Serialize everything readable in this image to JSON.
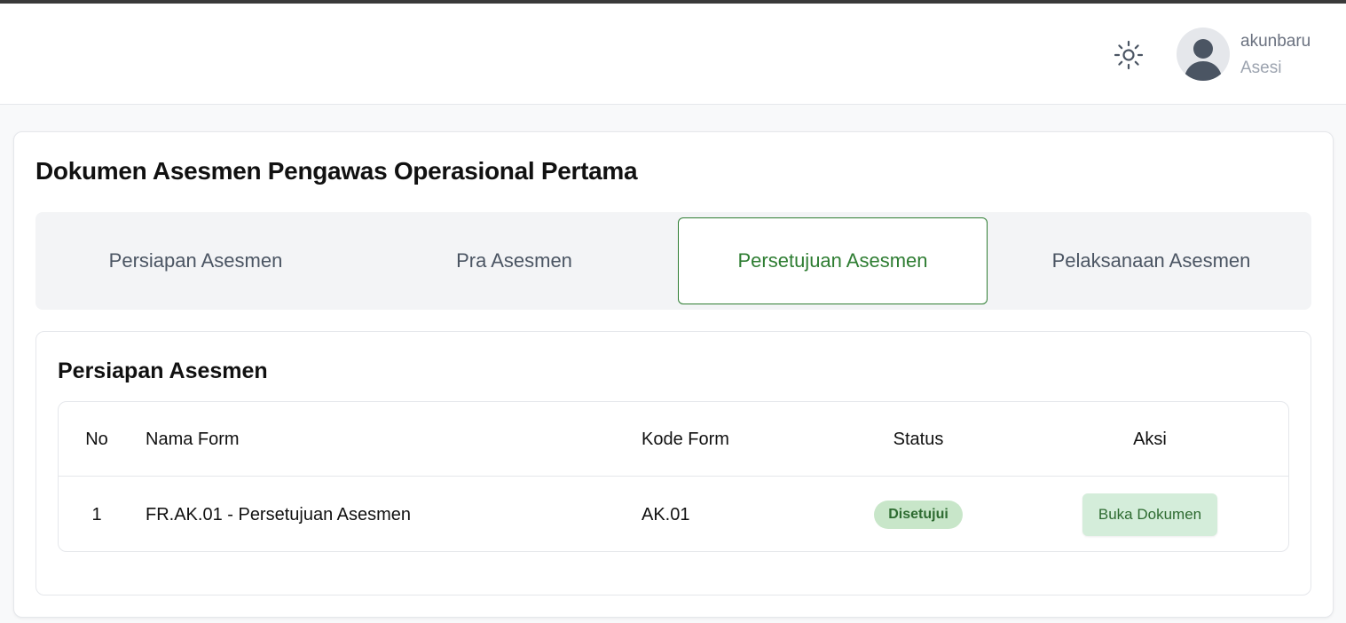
{
  "header": {
    "user_name": "akunbaru",
    "user_role": "Asesi",
    "theme_icon": "sun-icon",
    "avatar_icon": "user-avatar-icon"
  },
  "page": {
    "title": "Dokumen Asesmen Pengawas Operasional Pertama"
  },
  "tabs": [
    {
      "label": "Persiapan Asesmen",
      "active": false
    },
    {
      "label": "Pra Asesmen",
      "active": false
    },
    {
      "label": "Persetujuan Asesmen",
      "active": true
    },
    {
      "label": "Pelaksanaan Asesmen",
      "active": false
    }
  ],
  "section": {
    "title": "Persiapan Asesmen",
    "table": {
      "headers": {
        "no": "No",
        "name": "Nama Form",
        "code": "Kode Form",
        "status": "Status",
        "action": "Aksi"
      },
      "rows": [
        {
          "no": "1",
          "name": "FR.AK.01 - Persetujuan Asesmen",
          "code": "AK.01",
          "status": "Disetujui",
          "action_label": "Buka Dokumen"
        }
      ]
    }
  },
  "colors": {
    "accent": "#2e7d32",
    "badge_bg": "#c8e6c9",
    "button_bg": "#d4edda"
  }
}
